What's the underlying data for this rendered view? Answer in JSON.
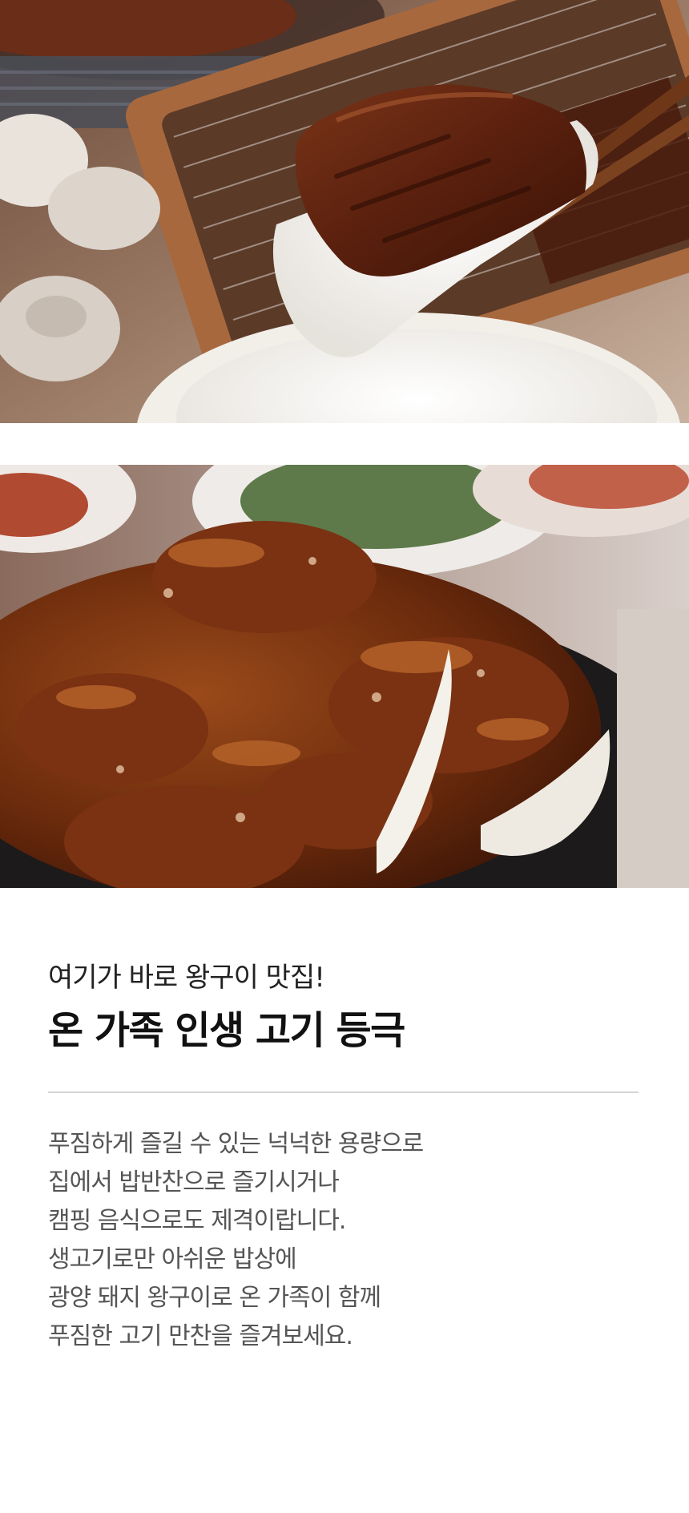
{
  "images": {
    "top_photo": "rice-with-grilled-pork-photo",
    "bottom_photo": "glazed-pork-bulgogi-photo"
  },
  "heading": {
    "subtitle": "여기가 바로 왕구이 맛집!",
    "title": "온 가족 인생 고기 등극"
  },
  "body": {
    "lines": [
      "푸짐하게 즐길 수 있는 넉넉한 용량으로",
      "집에서 밥반찬으로 즐기시거나",
      "캠핑 음식으로도 제격이랍니다.",
      "생고기로만 아쉬운 밥상에",
      "광양 돼지 왕구이로 온 가족이 함께",
      "푸짐한 고기 만찬을 즐겨보세요."
    ]
  },
  "colors": {
    "background": "#ffffff",
    "title": "#111111",
    "body": "#555555",
    "divider": "#d4d4d4"
  }
}
